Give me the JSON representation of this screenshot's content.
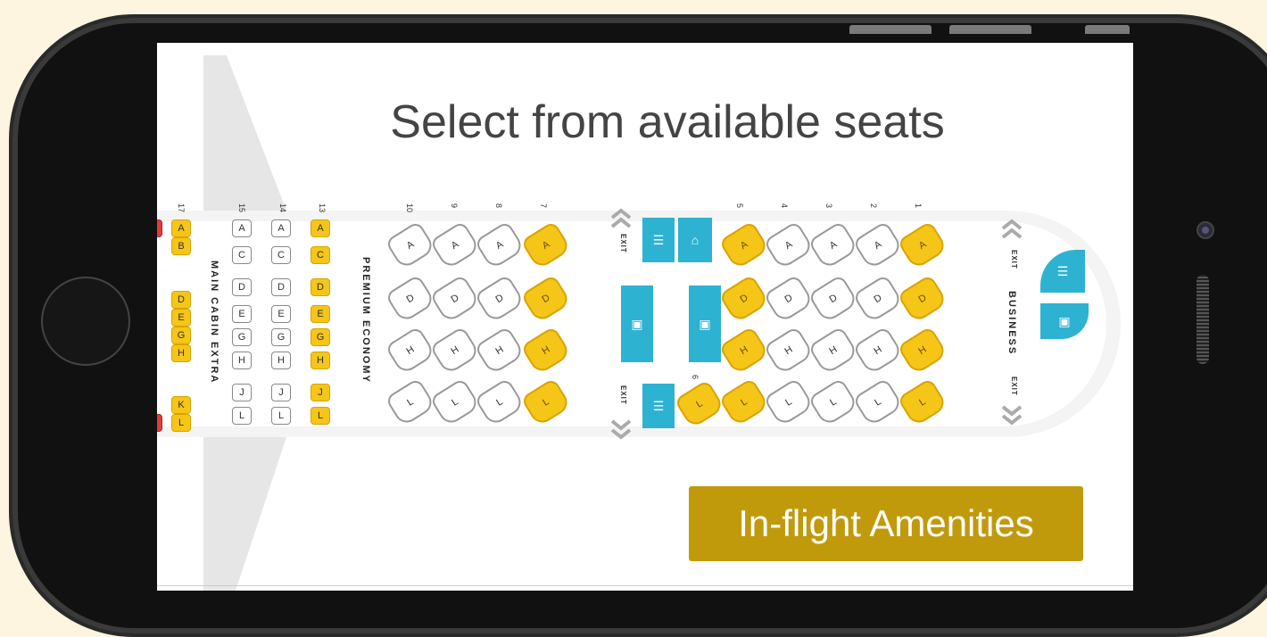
{
  "screen": {
    "title": "Select from available seats",
    "amenities_button": "In-flight Amenities"
  },
  "cabins": {
    "main_cabin_extra": "MAIN CABIN EXTRA",
    "premium_economy": "PREMIUM ECONOMY",
    "business": "BUSINESS"
  },
  "exit_label": "EXIT",
  "rows": {
    "r1": "1",
    "r2": "2",
    "r3": "3",
    "r4": "4",
    "r5": "5",
    "r6": "6",
    "r7": "7",
    "r8": "8",
    "r9": "9",
    "r10": "10",
    "r13": "13",
    "r14": "14",
    "r15": "15",
    "r17": "17"
  },
  "letters": {
    "A": "A",
    "B": "B",
    "C": "C",
    "D": "D",
    "E": "E",
    "G": "G",
    "H": "H",
    "J": "J",
    "K": "K",
    "L": "L"
  },
  "colors": {
    "available": "#f5c518",
    "occupied": "#ffffff",
    "unavailable": "#e23b3b",
    "facility": "#2eb2d1",
    "button": "#c19a0b"
  }
}
